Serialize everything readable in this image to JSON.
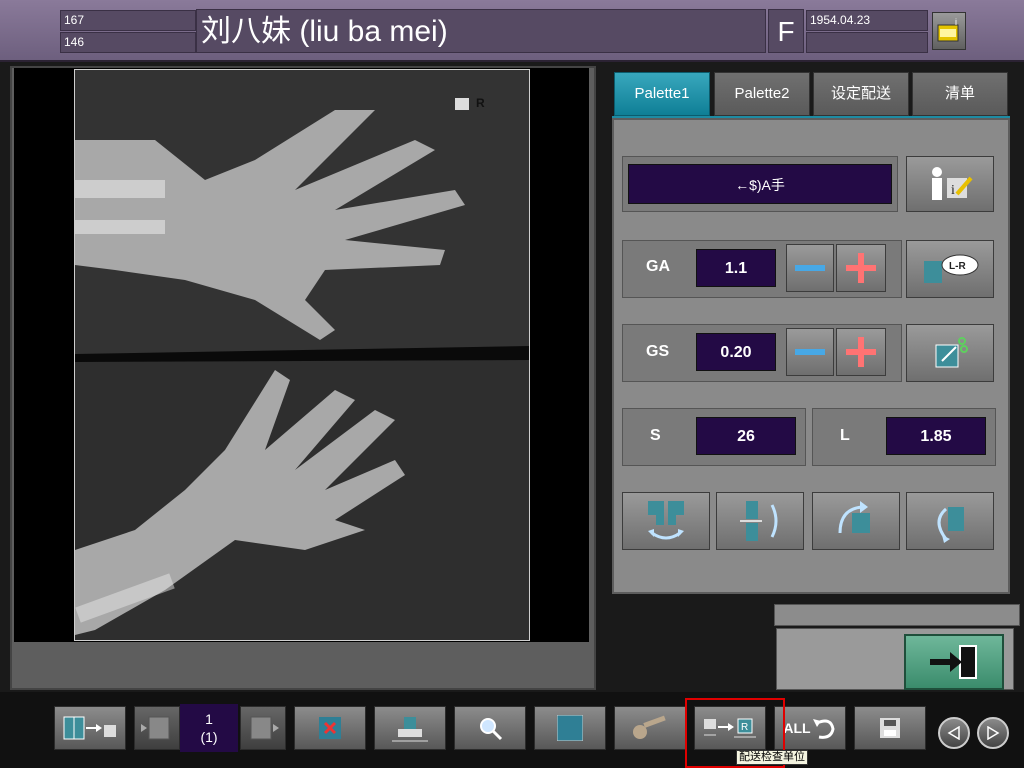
{
  "header": {
    "patient_id_top": "167",
    "patient_id_bottom": "146",
    "patient_name": "刘八妹 (liu ba mei)",
    "sex": "F",
    "birth_date": "1954.04.23",
    "birth_date_line2": ""
  },
  "tabs": [
    {
      "label": "Palette1",
      "active": true
    },
    {
      "label": "Palette2",
      "active": false
    },
    {
      "label": "设定配送",
      "active": false
    },
    {
      "label": "清单",
      "active": false
    }
  ],
  "exam": {
    "label": "←$)A手"
  },
  "ga": {
    "label": "GA",
    "value": "1.1"
  },
  "gs": {
    "label": "GS",
    "value": "0.20"
  },
  "s": {
    "label": "S",
    "value": "26"
  },
  "l": {
    "label": "L",
    "value": "1.85"
  },
  "film_marker": "R",
  "lr_label": "L-R",
  "pager": {
    "page": "1",
    "total": "(1)"
  },
  "toolbar": {
    "all_label": "ALL"
  },
  "tooltip": "配送检查单位",
  "colors": {
    "accent_tab": "#1d8ba3",
    "value_box": "#230a45",
    "exit_button": "#4fa282",
    "highlight": "#e00000"
  }
}
